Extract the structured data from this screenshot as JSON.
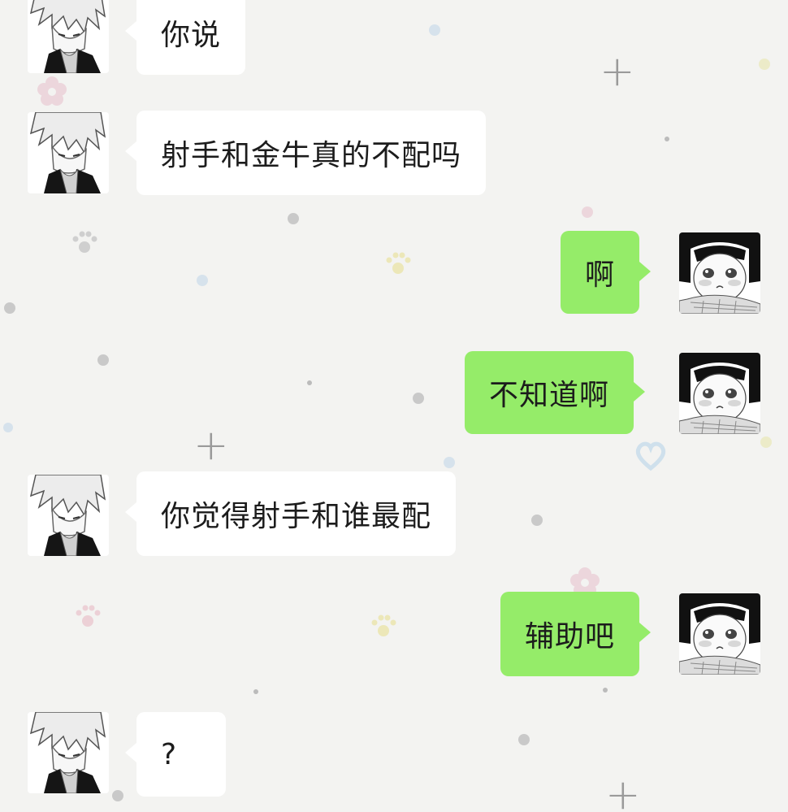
{
  "messages": [
    {
      "side": "left",
      "avatar": "boy-manga-avatar",
      "text": "你说"
    },
    {
      "side": "left",
      "avatar": "boy-manga-avatar",
      "text": "射手和金牛真的不配吗"
    },
    {
      "side": "right",
      "avatar": "girl-manga-avatar",
      "text": "啊"
    },
    {
      "side": "right",
      "avatar": "girl-manga-avatar",
      "text": "不知道啊"
    },
    {
      "side": "left",
      "avatar": "boy-manga-avatar",
      "text": "你觉得射手和谁最配"
    },
    {
      "side": "right",
      "avatar": "girl-manga-avatar",
      "text": "辅助吧"
    },
    {
      "side": "left",
      "avatar": "boy-manga-avatar",
      "text": "?"
    }
  ],
  "colors": {
    "background": "#f3f3f1",
    "incoming_bubble": "#ffffff",
    "outgoing_bubble": "#95ec69"
  }
}
